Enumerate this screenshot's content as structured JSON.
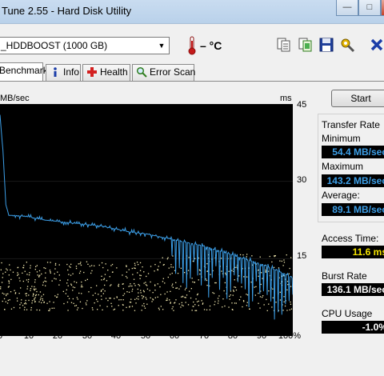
{
  "window": {
    "title": "Tune 2.55 - Hard Disk Utility",
    "buttons": {
      "minimize": "—",
      "maximize": "□"
    }
  },
  "toolbar": {
    "drive": "_HDDBOOST (1000 GB)",
    "temperature": "– °C",
    "icons": [
      "copy-text-icon",
      "copy-screenshot-icon",
      "save-icon",
      "options-icon",
      "exit-icon"
    ]
  },
  "tabs": [
    {
      "label": "Benchmark",
      "icon": ""
    },
    {
      "label": "Info",
      "icon": "info-icon"
    },
    {
      "label": "Health",
      "icon": "health-cross-icon"
    },
    {
      "label": "Error Scan",
      "icon": "magnifier-icon"
    }
  ],
  "chart_data": {
    "type": "line",
    "ylabel_left": "MB/sec",
    "ylabel_right": "ms",
    "x_ticks": [
      "0",
      "10",
      "20",
      "30",
      "40",
      "50",
      "60",
      "70",
      "80",
      "90",
      "100%"
    ],
    "right_ticks": [
      "45",
      "30",
      "15"
    ],
    "xlim": [
      0,
      100
    ],
    "right_ylim": [
      0,
      45
    ],
    "transfer_rate_series": {
      "name": "Transfer Rate",
      "x": [
        0,
        1,
        2,
        3,
        5,
        10,
        15,
        20,
        25,
        30,
        35,
        40,
        45,
        50,
        55,
        60,
        65,
        70,
        75,
        80,
        85,
        90,
        95,
        100
      ],
      "y": [
        143,
        120,
        85,
        78,
        78,
        77,
        75,
        74,
        73,
        72,
        71,
        69,
        67,
        66,
        64,
        62,
        60,
        58,
        55,
        52,
        49,
        46,
        42,
        38
      ]
    },
    "access_time_scatter": {
      "name": "Access Time",
      "range_ms": [
        5,
        15
      ]
    }
  },
  "controls": {
    "start_label": "Start"
  },
  "results": {
    "transfer_rate_title": "Transfer Rate",
    "minimum_label": "Minimum",
    "minimum_value": "54.4 MB/sec",
    "maximum_label": "Maximum",
    "maximum_value": "143.2 MB/sec",
    "average_label": "Average:",
    "average_value": "89.1 MB/sec",
    "access_time_label": "Access Time:",
    "access_time_value": "11.6 ms",
    "burst_rate_label": "Burst Rate",
    "burst_rate_value": "136.1 MB/sec",
    "cpu_usage_label": "CPU Usage",
    "cpu_usage_value": "-1.0%"
  },
  "colors": {
    "chart_background": "#000000",
    "transfer_line": "#3c9fe8",
    "scatter_points": "#f3e9b0",
    "value_blue": "#3c9fe8",
    "value_yellow": "#f5e400",
    "value_white": "#ffffff"
  }
}
